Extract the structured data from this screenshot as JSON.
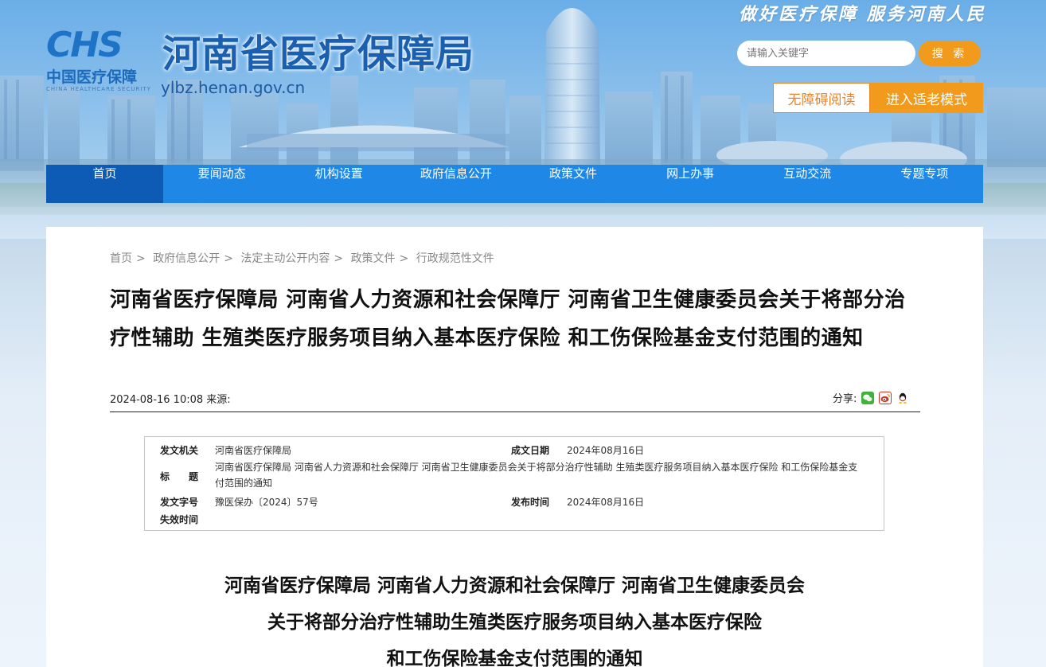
{
  "header": {
    "logo_mark": "CHS",
    "logo_cn": "中国医疗保障",
    "logo_en": "CHINA HEALTHCARE SECURITY",
    "site_title": "河南省医疗保障局",
    "site_url": "ylbz.henan.gov.cn",
    "slogan": "做好医疗保障  服务河南人民",
    "search_placeholder": "请输入关键字",
    "search_button": "搜 索",
    "accessibility_button": "无障碍阅读",
    "elder_mode_button": "进入适老模式"
  },
  "nav": {
    "items": [
      "首页",
      "要闻动态",
      "机构设置",
      "政府信息公开",
      "政策文件",
      "网上办事",
      "互动交流",
      "专题专项"
    ],
    "active": "首页"
  },
  "breadcrumb": [
    "首页",
    "政府信息公开",
    "法定主动公开内容",
    "政策文件",
    "行政规范性文件"
  ],
  "article": {
    "title": "河南省医疗保障局 河南省人力资源和社会保障厅 河南省卫生健康委员会关于将部分治疗性辅助 生殖类医疗服务项目纳入基本医疗保险 和工伤保险基金支付范围的通知",
    "date": "2024-08-16 10:08",
    "source_label": "来源:",
    "share_label": "分享:"
  },
  "info_box": {
    "issuer_label": "发文机关",
    "issuer": "河南省医疗保障局",
    "written_date_label": "成文日期",
    "written_date": "2024年08月16日",
    "title_label": "标　　题",
    "title": "河南省医疗保障局 河南省人力资源和社会保障厅 河南省卫生健康委员会关于将部分治疗性辅助 生殖类医疗服务项目纳入基本医疗保险 和工伤保险基金支付范围的通知",
    "doc_no_label": "发文字号",
    "doc_no": "豫医保办〔2024〕57号",
    "publish_date_label": "发布时间",
    "publish_date": "2024年08月16日",
    "expiry_label": "失效时间",
    "expiry": ""
  },
  "doc_heading": {
    "line1": "河南省医疗保障局  河南省人力资源和社会保障厅  河南省卫生健康委员会",
    "line2": "关于将部分治疗性辅助生殖类医疗服务项目纳入基本医疗保险",
    "line3": "和工伤保险基金支付范围的通知"
  },
  "colors": {
    "nav_bg": "#1f87e5",
    "nav_active": "#0d5bb5",
    "accent_orange": "#f29a1b",
    "brand_blue": "#1b5fb1"
  }
}
